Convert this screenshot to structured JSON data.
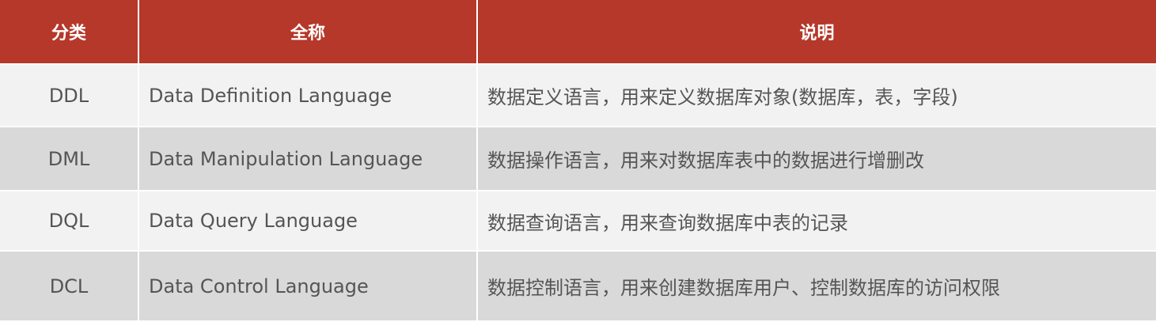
{
  "headers": [
    "分类",
    "全称",
    "说明"
  ],
  "rows": [
    {
      "category": "DDL",
      "full_name": "Data Definition Language",
      "description": "数据定义语言，用来定义数据库对象(数据库，表，字段)"
    },
    {
      "category": "DML",
      "full_name": "Data Manipulation Language",
      "description": "数据操作语言，用来对数据库表中的数据进行增删改"
    },
    {
      "category": "DQL",
      "full_name": "Data Query Language",
      "description": "数据查询语言，用来查询数据库中表的记录"
    },
    {
      "category": "DCL",
      "full_name": "Data Control Language",
      "description": "数据控制语言，用来创建数据库用户、控制数据库的访问权限"
    }
  ],
  "colors": {
    "header_bg": "#b5382a",
    "row_light": "#f2f2f2",
    "row_dark": "#d9d9d9",
    "text": "#555555"
  }
}
